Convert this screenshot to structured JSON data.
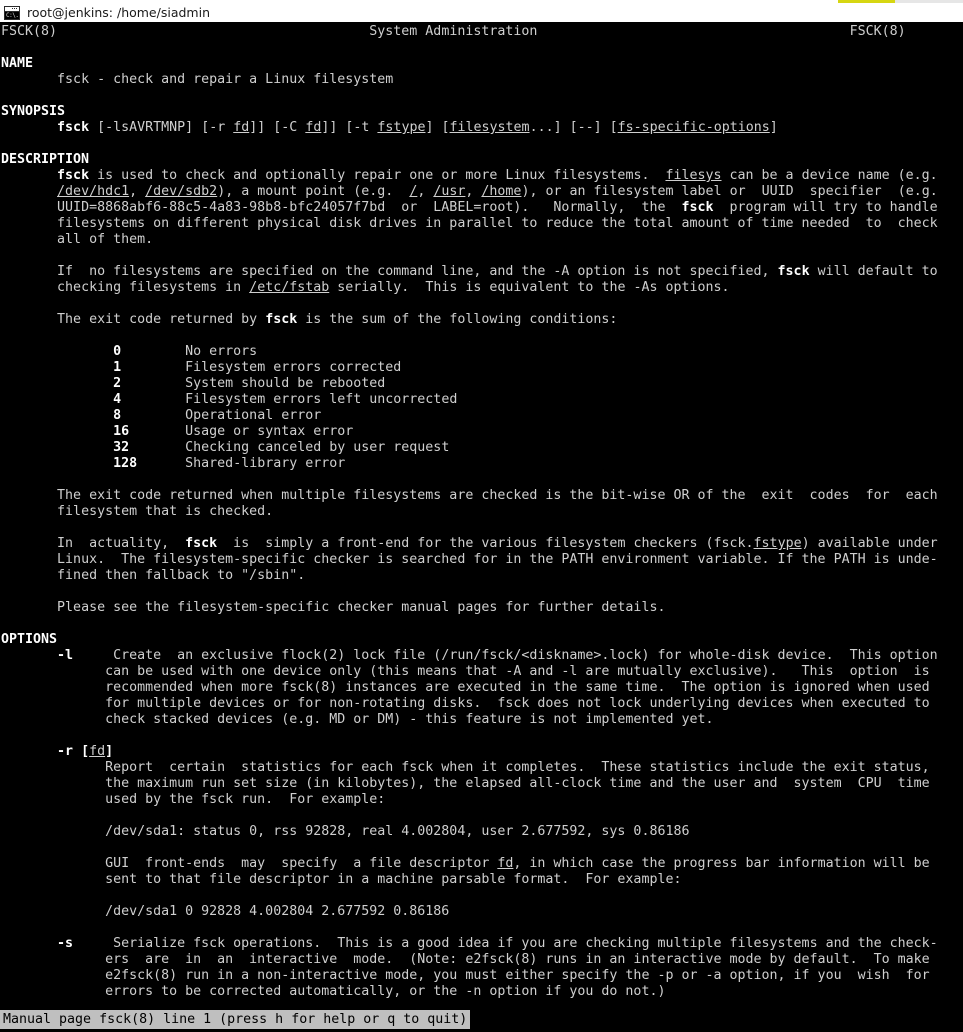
{
  "window": {
    "title": "root@jenkins: /home/siadmin",
    "icon": "terminal-icon",
    "icon_glyph": "C:\\.",
    "colors": {
      "terminal_bg": "#000000",
      "terminal_fg": "#cfcfcf",
      "bold_fg": "#ffffff",
      "status_bg": "#bfbfbf",
      "status_fg": "#000000",
      "accent_yellow": "#d6d611"
    }
  },
  "top_indicator": {
    "name": "loading-indicator",
    "track_color": "#e6e6e6",
    "fill_color": "#d6d611"
  },
  "manpage": {
    "header_left": "FSCK(8)",
    "header_center": "System Administration",
    "header_right": "FSCK(8)",
    "sections": {
      "name_heading": "NAME",
      "name_body": "fsck - check and repair a Linux filesystem",
      "synopsis_heading": "SYNOPSIS",
      "description_heading": "DESCRIPTION",
      "options_heading": "OPTIONS"
    },
    "synopsis": {
      "command": "fsck",
      "flags": "[-lsAVRTMNP]",
      "r_opt": "[-r",
      "fd1": "fd",
      "r_close": "]]",
      "c_opt": "[-C",
      "fd2": "fd",
      "c_close": "]]",
      "t_opt": "[-t",
      "fstype": "fstype",
      "t_close": "]",
      "filesystem": "filesystem",
      "filesystem_ellipsis": "...]",
      "dashdash": "[--]",
      "fs_specific": "fs-specific-options",
      "fs_specific_close": "]"
    },
    "exit_codes": {
      "intro": "The exit code returned by fsck is the sum of the following conditions:",
      "rows": [
        {
          "code": "0",
          "desc": "No errors"
        },
        {
          "code": "1",
          "desc": "Filesystem errors corrected"
        },
        {
          "code": "2",
          "desc": "System should be rebooted"
        },
        {
          "code": "4",
          "desc": "Filesystem errors left uncorrected"
        },
        {
          "code": "8",
          "desc": "Operational error"
        },
        {
          "code": "16",
          "desc": "Usage or syntax error"
        },
        {
          "code": "32",
          "desc": "Checking canceled by user request"
        },
        {
          "code": "128",
          "desc": "Shared-library error"
        }
      ]
    },
    "description_lines": {
      "d1_pre": "fsck",
      "d1_mid": " is used to check and optionally repair one or more Linux filesystems.  ",
      "d1_link": "filesys",
      "d1_post": " can be a device name (e.g.",
      "d2_a": "/dev/hdc1",
      "d2_b": ", ",
      "d2_c": "/dev/sdb2",
      "d2_d": "), a mount point (e.g.  ",
      "d2_e": "/",
      "d2_f": ", ",
      "d2_g": "/usr",
      "d2_h": ", ",
      "d2_i": "/home",
      "d2_j": "), or an filesystem label or  UUID  specifier  (e.g.",
      "d3_pre": "UUID=8868abf6-88c5-4a83-98b8-bfc24057f7bd  or  LABEL=root).   Normally,  the  ",
      "d3_bold": "fsck",
      "d3_post": "  program will try to handle",
      "d4": "filesystems on different physical disk drives in parallel to reduce the total amount of time needed  to  check",
      "d5": "all of them.",
      "f1_pre": "If  no filesystems are specified on the command line, and the -A option is not specified, ",
      "f1_bold": "fsck",
      "f1_post": " will default to",
      "f2_pre": "checking filesystems in ",
      "f2_link": "/etc/fstab",
      "f2_post": " serially.  This is equivalent to the -As options.",
      "m1": "The exit code returned when multiple filesystems are checked is the bit-wise OR of the  exit  codes  for  each",
      "m2": "filesystem that is checked.",
      "a1_pre": "In  actuality,  ",
      "a1_bold": "fsck",
      "a1_mid": "  is  simply a front-end for the various filesystem checkers (fsck.",
      "a1_link": "fstype",
      "a1_post": ") available under",
      "a2": "Linux.  The filesystem-specific checker is searched for in the PATH environment variable. If the PATH is unde-",
      "a3": "fined then fallback to \"/sbin\".",
      "p1": "Please see the filesystem-specific checker manual pages for further details."
    },
    "options": [
      {
        "flag": "-l",
        "lines": [
          "Create  an exclusive flock(2) lock file (/run/fsck/<diskname>.lock) for whole-disk device.  This option",
          "can be used with one device only (this means that -A and -l are mutually exclusive).   This  option  is",
          "recommended when more fsck(8) instances are executed in the same time.  The option is ignored when used",
          "for multiple devices or for non-rotating disks.  fsck does not lock underlying devices when executed to",
          "check stacked devices (e.g. MD or DM) - this feature is not implemented yet."
        ]
      },
      {
        "flag_pre": "-r [",
        "flag_link": "fd",
        "flag_post": "]",
        "lines": [
          "Report  certain  statistics for each fsck when it completes.  These statistics include the exit status,",
          "the maximum run set size (in kilobytes), the elapsed all-clock time and the user and  system  CPU  time",
          "used by the fsck run.  For example:",
          "",
          "/dev/sda1: status 0, rss 92828, real 4.002804, user 2.677592, sys 0.86186",
          "",
          "GUI  front-ends  may  specify  a file descriptor fd, in which case the progress bar information will be",
          "sent to that file descriptor in a machine parsable format.  For example:",
          "",
          "/dev/sda1 0 92828 4.002804 2.677592 0.86186"
        ]
      },
      {
        "flag": "-s",
        "lines": [
          "Serialize fsck operations.  This is a good idea if you are checking multiple filesystems and the check-",
          "ers  are  in  an  interactive  mode.  (Note: e2fsck(8) runs in an interactive mode by default.  To make",
          "e2fsck(8) run in a non-interactive mode, you must either specify the -p or -a option, if you  wish  for",
          "errors to be corrected automatically, or the -n option if you do not.)"
        ]
      }
    ]
  },
  "status_bar": {
    "text": "Manual page fsck(8) line 1 (press h for help or q to quit)"
  }
}
